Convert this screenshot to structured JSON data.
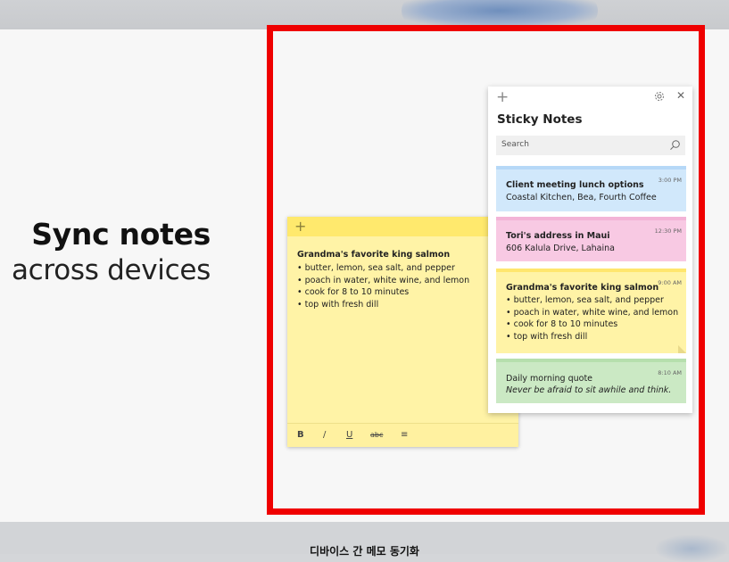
{
  "headline": {
    "line1": "Sync notes",
    "line2": "across devices"
  },
  "caption": "디바이스 간 메모 동기화",
  "big_note": {
    "plus": "+",
    "menu": "···",
    "title": "Grandma's favorite king salmon",
    "items": [
      "butter, lemon, sea salt, and pepper",
      "poach in water, white wine, and lemon",
      "cook for 8 to 10 minutes",
      "top with fresh dill"
    ],
    "toolbar": {
      "bold": "B",
      "italic": "/",
      "underline": "U",
      "strike": "abc",
      "list": "≡"
    }
  },
  "app": {
    "plus": "+",
    "close": "✕",
    "title": "Sticky Notes",
    "search_placeholder": "Search",
    "cards": [
      {
        "time": "3:00 PM",
        "title": "Client meeting lunch options",
        "body": "Coastal Kitchen, Bea, Fourth Coffee"
      },
      {
        "time": "12:30 PM",
        "title": "Tori's address in Maui",
        "body": "606 Kalula Drive, Lahaina"
      },
      {
        "time": "9:00 AM",
        "title": "Grandma's favorite king salmon",
        "items": [
          "butter, lemon, sea salt, and pepper",
          "poach in water, white wine, and lemon",
          "cook for 8 to 10 minutes",
          "top with fresh dill"
        ]
      },
      {
        "time": "8:10 AM",
        "body": "Daily morning quote",
        "quote": "Never be afraid to sit awhile and think."
      }
    ]
  },
  "colors": {
    "frame": "#ef0000",
    "note_yellow": "#fff3a6",
    "note_blue": "#d1e8fb",
    "note_pink": "#f8c9e3",
    "note_green": "#cbe9c4"
  }
}
